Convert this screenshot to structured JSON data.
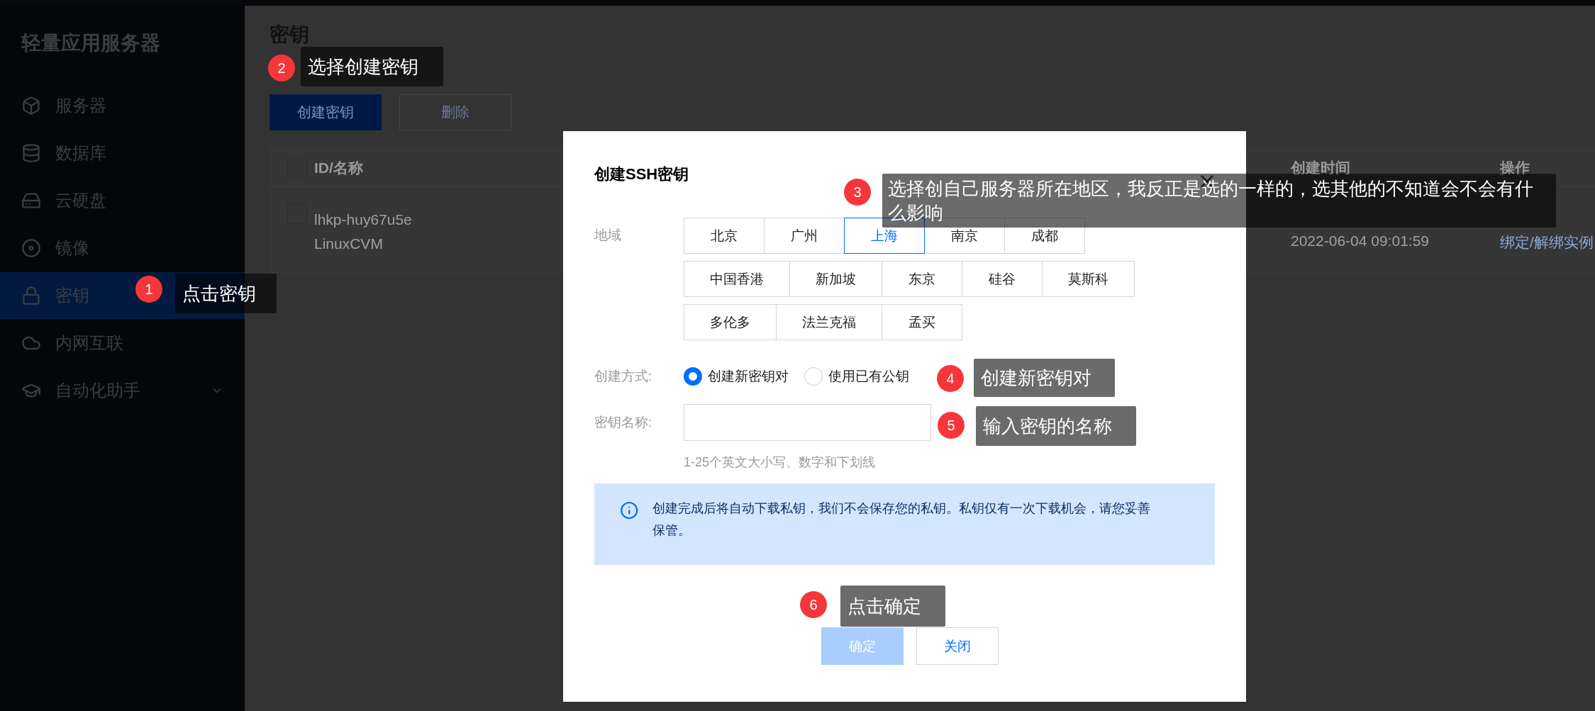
{
  "sidebar": {
    "title": "轻量应用服务器",
    "items": [
      {
        "label": "服务器",
        "selected": false
      },
      {
        "label": "数据库",
        "selected": false
      },
      {
        "label": "云硬盘",
        "selected": false
      },
      {
        "label": "镜像",
        "selected": false
      },
      {
        "label": "密钥",
        "selected": true
      },
      {
        "label": "内网互联",
        "selected": false
      },
      {
        "label": "自动化助手",
        "selected": false,
        "expanded": false
      }
    ]
  },
  "page": {
    "title": "密钥",
    "buttons": [
      {
        "label": "创建密钥",
        "kind": "primary",
        "disabled": false
      },
      {
        "label": "删除",
        "kind": "default",
        "disabled": true
      }
    ]
  },
  "table": {
    "header_checked": false,
    "columns": [
      "ID/名称",
      "创建时间",
      "操作"
    ],
    "rows": [
      {
        "checked": false,
        "id": "lhkp-huy67u5e",
        "name": "LinuxCVM",
        "created": "2022-06-04 09:01:59",
        "action": "绑定/解绑实例"
      }
    ]
  },
  "dialog": {
    "title": "创建SSH密钥",
    "region_label": "地域",
    "regions": [
      [
        {
          "label": "北京",
          "selected": false
        },
        {
          "label": "广州",
          "selected": false
        },
        {
          "label": "上海",
          "selected": true
        },
        {
          "label": "南京",
          "selected": false
        },
        {
          "label": "成都",
          "selected": false
        }
      ],
      [
        {
          "label": "中国香港",
          "selected": false
        },
        {
          "label": "新加坡",
          "selected": false
        },
        {
          "label": "东京",
          "selected": false
        },
        {
          "label": "硅谷",
          "selected": false
        },
        {
          "label": "莫斯科",
          "selected": false
        }
      ],
      [
        {
          "label": "多伦多",
          "selected": false
        },
        {
          "label": "法兰克福",
          "selected": false
        },
        {
          "label": "孟买",
          "selected": false
        }
      ]
    ],
    "method_label": "创建方式:",
    "methods": [
      {
        "label": "创建新密钥对",
        "selected": true
      },
      {
        "label": "使用已有公钥",
        "selected": false
      }
    ],
    "name_label": "密钥名称:",
    "hint": "1-25个英文大小写、数字和下划线",
    "notice": "创建完成后将自动下载私钥，我们不会保存您的私钥。私钥仅有一次下载机会，请您妥善保管。",
    "buttons": [
      {
        "label": "确定",
        "kind": "primary",
        "disabled": true
      },
      {
        "label": "关闭",
        "kind": "default",
        "disabled": false
      }
    ]
  },
  "annotations": [
    {
      "number": "1",
      "text": "点击密钥"
    },
    {
      "number": "2",
      "text": "选择创建密钥"
    },
    {
      "number": "3",
      "text": "选择创自己服务器所在地区，我反正是选的一样的，选其他的不知道会不会有什么影响"
    },
    {
      "number": "4",
      "text": "创建新密钥对"
    },
    {
      "number": "5",
      "text": "输入密钥的名称"
    },
    {
      "number": "6",
      "text": "点击确定"
    }
  ]
}
